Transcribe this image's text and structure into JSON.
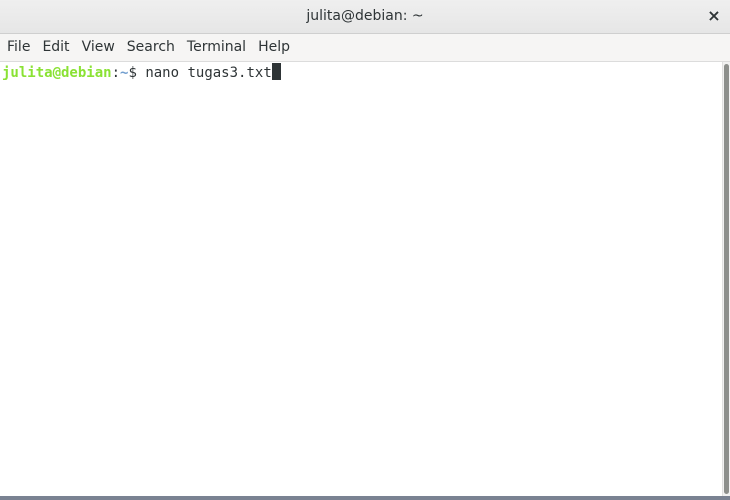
{
  "window": {
    "title": "julita@debian: ~",
    "close_label": "×"
  },
  "menu": [
    {
      "label": "File"
    },
    {
      "label": "Edit"
    },
    {
      "label": "View"
    },
    {
      "label": "Search"
    },
    {
      "label": "Terminal"
    },
    {
      "label": "Help"
    }
  ],
  "terminal": {
    "prompt_user_host": "julita@debian",
    "prompt_separator": ":",
    "prompt_path": "~",
    "prompt_symbol": "$ ",
    "command": "nano tugas3.txt"
  },
  "colors": {
    "prompt_user_host": "#8ae234",
    "prompt_path": "#729fcf",
    "text": "#2e3436"
  }
}
